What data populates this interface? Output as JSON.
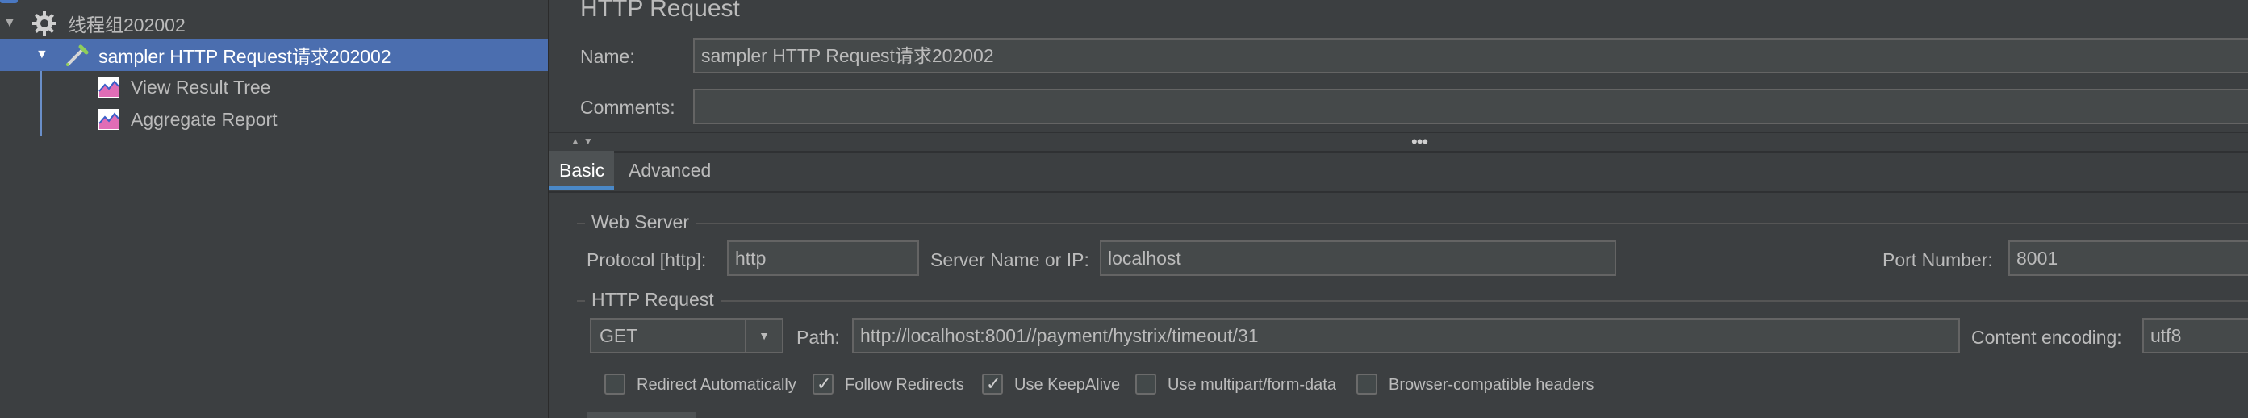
{
  "tree": {
    "items": [
      {
        "label": "线程组202002",
        "icon": "gear-icon",
        "expanded": true
      },
      {
        "label": "sampler HTTP Request请求202002",
        "icon": "pipette-icon",
        "expanded": true,
        "selected": true
      },
      {
        "label": "View Result Tree",
        "icon": "graph-icon"
      },
      {
        "label": "Aggregate Report",
        "icon": "graph-icon"
      }
    ]
  },
  "panel": {
    "title": "HTTP Request",
    "name_label": "Name:",
    "name_value": "sampler HTTP Request请求202002",
    "comments_label": "Comments:",
    "comments_value": "",
    "tabs": [
      "Basic",
      "Advanced"
    ],
    "web_server": {
      "title": "Web Server",
      "protocol_label": "Protocol [http]:",
      "protocol_value": "http",
      "server_label": "Server Name or IP:",
      "server_value": "localhost",
      "port_label": "Port Number:",
      "port_value": "8001"
    },
    "http_request": {
      "title": "HTTP Request",
      "method": "GET",
      "path_label": "Path:",
      "path_value": "http://localhost:8001//payment/hystrix/timeout/31",
      "encoding_label": "Content encoding:",
      "encoding_value": "utf8"
    },
    "options": [
      {
        "label": "Redirect Automatically",
        "checked": false
      },
      {
        "label": "Follow Redirects",
        "checked": true
      },
      {
        "label": "Use KeepAlive",
        "checked": true
      },
      {
        "label": "Use multipart/form-data",
        "checked": false
      },
      {
        "label": "Browser-compatible headers",
        "checked": false
      }
    ]
  },
  "colors": {
    "background": "#3c3f41",
    "selection": "#4b6eaf",
    "field": "#45494a",
    "text": "#bbbbbb"
  }
}
